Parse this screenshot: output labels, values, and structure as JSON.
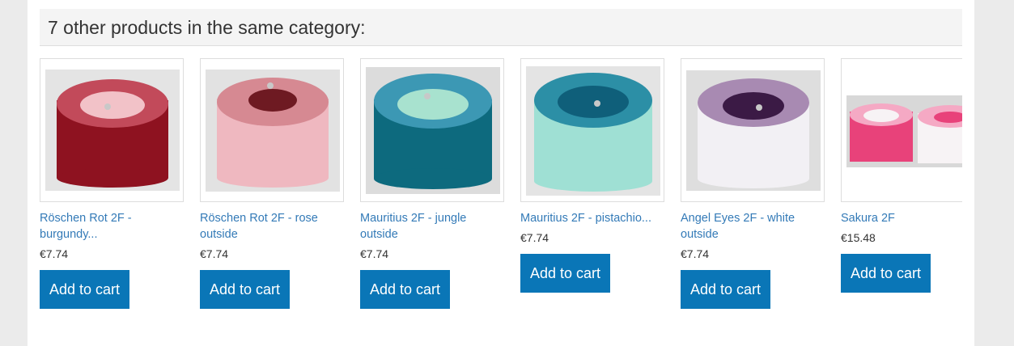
{
  "section": {
    "title": "7 other products in the same category:"
  },
  "products": [
    {
      "name_line1": "Röschen Rot 2F -",
      "name_line2": "burgundy...",
      "price": "€7.74",
      "button_label": "Add to cart",
      "colors": {
        "outer": "#8e1220",
        "mid": "#c24a5a",
        "inner": "#f2c2c8",
        "bg": "#e4e4e4"
      }
    },
    {
      "name_line1": "Röschen Rot 2F - rose",
      "name_line2": "outside",
      "price": "€7.74",
      "button_label": "Add to cart",
      "colors": {
        "outer": "#efb8c0",
        "mid": "#d68992",
        "inner": "#6e1a22",
        "bg": "#e2e2e2"
      }
    },
    {
      "name_line1": "Mauritius 2F - jungle",
      "name_line2": "outside",
      "price": "€7.74",
      "button_label": "Add to cart",
      "colors": {
        "outer": "#0d6a7e",
        "mid": "#3c98b4",
        "inner": "#a8e2cf",
        "bg": "#dcdcdc"
      }
    },
    {
      "name_line1": "Mauritius 2F - pistachio...",
      "name_line2": "",
      "price": "€7.74",
      "button_label": "Add to cart",
      "colors": {
        "outer": "#9fe0d4",
        "mid": "#2c8fa6",
        "inner": "#0f5f7a",
        "bg": "#e4e4e4"
      }
    },
    {
      "name_line1": "Angel Eyes 2F - white",
      "name_line2": "outside",
      "price": "€7.74",
      "button_label": "Add to cart",
      "colors": {
        "outer": "#f2f0f4",
        "mid": "#a88ab2",
        "inner": "#3b1a45",
        "bg": "#dedede"
      }
    },
    {
      "name_line1": "Sakura 2F",
      "name_line2": "",
      "price": "€15.48",
      "button_label": "Add to cart",
      "colors": {
        "outer": "#e8427a",
        "mid": "#f5a9c4",
        "inner": "#f7f3f5",
        "bg": "#d8d8d8"
      }
    }
  ]
}
